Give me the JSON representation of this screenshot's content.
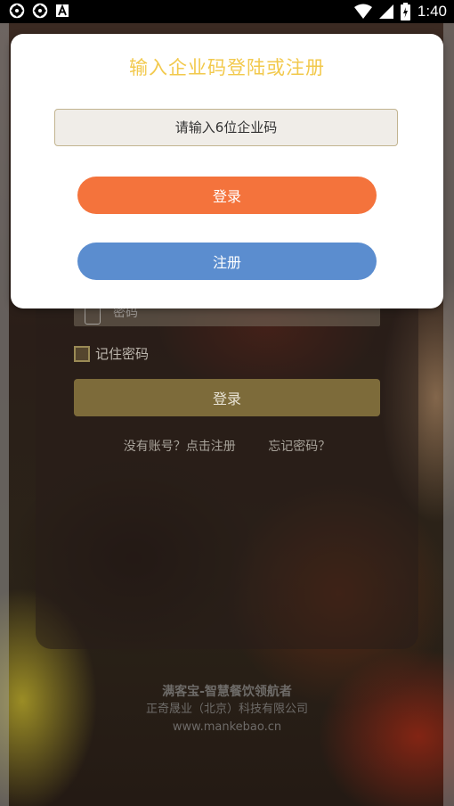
{
  "status_bar": {
    "time": "1:40"
  },
  "dialog": {
    "title": "输入企业码登陆或注册",
    "code_placeholder": "请输入6位企业码",
    "login_label": "登录",
    "register_label": "注册"
  },
  "background": {
    "password_placeholder": "密码",
    "remember_label": "记住密码",
    "login_label": "登录",
    "register_link": "没有账号？点击注册",
    "forgot_link": "忘记密码？",
    "footer_brand": "满客宝-智慧餐饮领航者",
    "footer_company": "正奇晟业（北京）科技有限公司",
    "footer_url": "www.mankebao.cn"
  },
  "colors": {
    "title": "#f2c94c",
    "login_button": "#f4733c",
    "register_button": "#5b8dcf",
    "input_border": "#c2b490"
  }
}
